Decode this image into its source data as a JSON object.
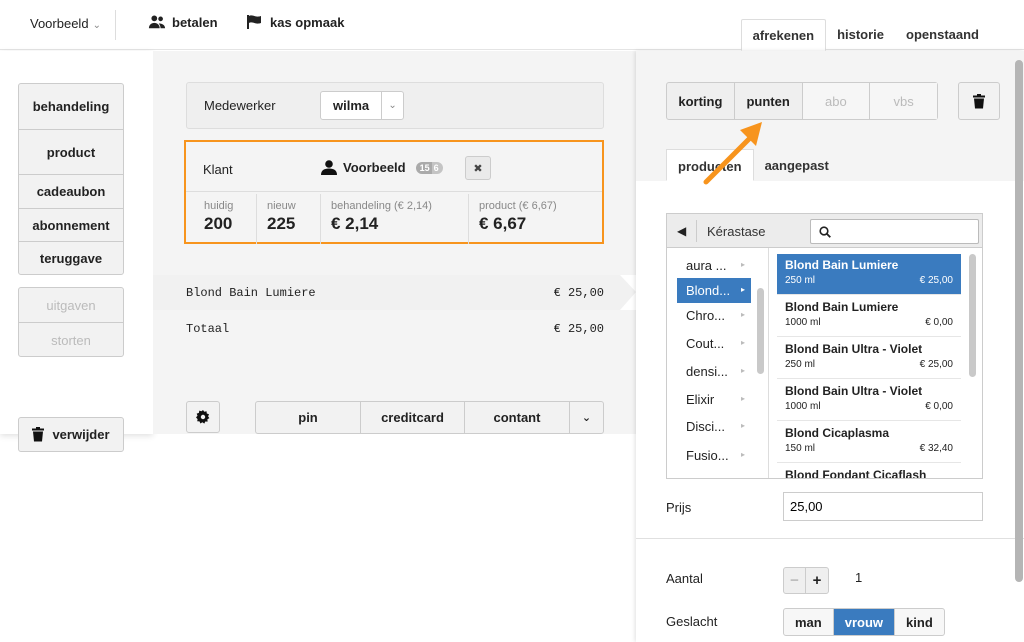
{
  "topbar": {
    "org": "Voorbeeld",
    "nav": [
      {
        "label": "betalen",
        "icon": "users-icon"
      },
      {
        "label": "kas opmaak",
        "icon": "flag-icon"
      }
    ],
    "tabs": [
      "afrekenen",
      "historie",
      "openstaand"
    ],
    "active_tab": "afrekenen"
  },
  "left": {
    "menu_main": [
      "behandeling",
      "product",
      "cadeaubon",
      "abonnement",
      "teruggave"
    ],
    "menu_secondary": [
      "uitgaven",
      "storten"
    ],
    "delete_label": "verwijder"
  },
  "medewerker": {
    "label": "Medewerker",
    "value": "wilma"
  },
  "klant": {
    "label": "Klant",
    "name": "Voorbeeld",
    "badges": [
      "15",
      "6"
    ],
    "stats": [
      {
        "label": "huidig",
        "value": "200"
      },
      {
        "label": "nieuw",
        "value": "225"
      },
      {
        "label": "behandeling (€ 2,14)",
        "value": "€ 2,14"
      },
      {
        "label": "product (€ 6,67)",
        "value": "€ 6,67"
      }
    ]
  },
  "lines": [
    {
      "name": "Blond Bain Lumiere",
      "price": "€ 25,00"
    }
  ],
  "total": {
    "label": "Totaal",
    "price": "€ 25,00"
  },
  "payment": [
    "pin",
    "creditcard",
    "contant"
  ],
  "discounts": [
    {
      "label": "korting",
      "enabled": true
    },
    {
      "label": "punten",
      "enabled": true
    },
    {
      "label": "abo",
      "enabled": false
    },
    {
      "label": "vbs",
      "enabled": false
    }
  ],
  "subtabs": [
    "producten",
    "aangepast"
  ],
  "browser": {
    "brand": "Kérastase",
    "search_placeholder": "",
    "categories": [
      "aura ...",
      "Blond...",
      "Chro...",
      "Cout...",
      "densi...",
      "Elixir",
      "Disci...",
      "Fusio..."
    ],
    "selected_category": "Blond...",
    "products": [
      {
        "name": "Blond Bain Lumiere",
        "size": "250 ml",
        "price": "€ 25,00",
        "selected": true
      },
      {
        "name": "Blond Bain Lumiere",
        "size": "1000 ml",
        "price": "€ 0,00"
      },
      {
        "name": "Blond Bain Ultra - Violet",
        "size": "250 ml",
        "price": "€ 25,00"
      },
      {
        "name": "Blond Bain Ultra - Violet",
        "size": "1000 ml",
        "price": "€ 0,00"
      },
      {
        "name": "Blond Cicaplasma",
        "size": "150 ml",
        "price": "€ 32,40"
      },
      {
        "name": "Blond Fondant Cicaflash",
        "size": "",
        "price": ""
      }
    ]
  },
  "prijs": {
    "label": "Prijs",
    "value": "25,00"
  },
  "aantal": {
    "label": "Aantal",
    "value": "1",
    "minus": "−",
    "plus": "+"
  },
  "geslacht": {
    "label": "Geslacht",
    "options": [
      "man",
      "vrouw",
      "kind"
    ],
    "active": "vrouw"
  },
  "colors": {
    "accent": "#3a7bbf",
    "highlight": "#f7941d"
  }
}
